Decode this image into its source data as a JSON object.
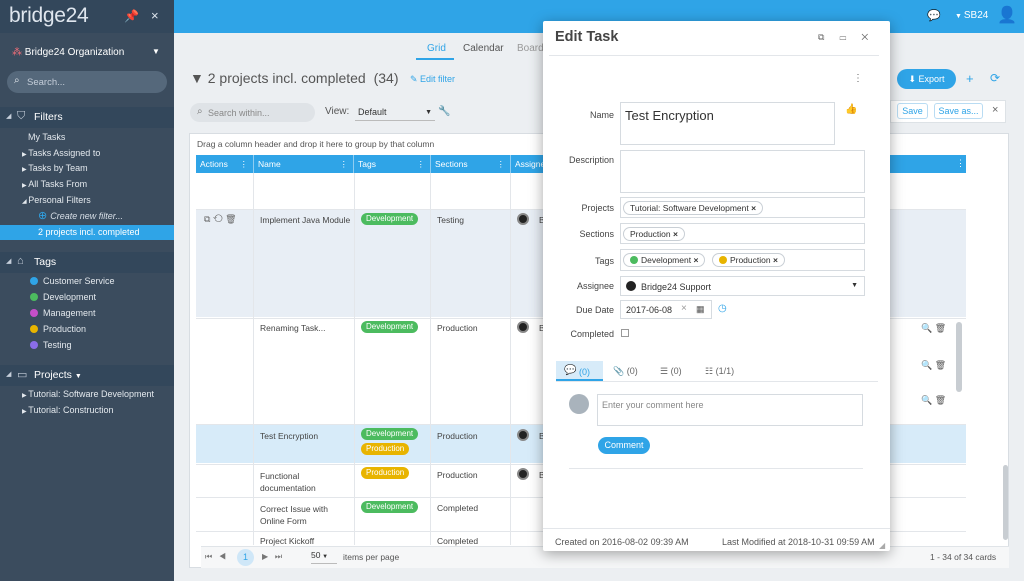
{
  "app": {
    "logo": "bridge24",
    "user": "SB24"
  },
  "sidebar": {
    "org": "Bridge24 Organization",
    "search_placeholder": "Search...",
    "filters_title": "Filters",
    "filters": [
      "My Tasks",
      "Tasks Assigned to",
      "Tasks by Team",
      "All Tasks From",
      "Personal Filters",
      "Create new filter...",
      "2 projects incl. completed"
    ],
    "tags_title": "Tags",
    "tags": [
      {
        "label": "Customer Service",
        "color": "#2fa4e7"
      },
      {
        "label": "Development",
        "color": "#4cbb5f"
      },
      {
        "label": "Management",
        "color": "#c64fc9"
      },
      {
        "label": "Production",
        "color": "#e8b400"
      },
      {
        "label": "Testing",
        "color": "#8a6de9"
      }
    ],
    "projects_title": "Projects",
    "projects": [
      "Tutorial: Software Development",
      "Tutorial: Construction"
    ]
  },
  "view": {
    "tabs": [
      "Grid",
      "Calendar",
      "Board"
    ],
    "title": "2 projects incl. completed",
    "count": "(34)",
    "edit_filter": "Edit filter",
    "search_placeholder": "Search within...",
    "view_label": "View:",
    "view_value": "Default",
    "export": "Export",
    "save": "Save",
    "save_as": "Save as...",
    "group_hint": "Drag a column header and drop it here to group by that column",
    "columns": [
      "Actions",
      "Name",
      "Tags",
      "Sections",
      "Assignee"
    ],
    "rows": [
      {
        "name": "Implement Java Module",
        "tags": [
          "Development"
        ],
        "section": "Testing",
        "assignee": "B"
      },
      {
        "name": "Renaming Task...",
        "tags": [
          "Development"
        ],
        "section": "Production",
        "assignee": "B"
      },
      {
        "name": "Test Encryption",
        "tags": [
          "Development",
          "Production"
        ],
        "section": "Production",
        "assignee": "B"
      },
      {
        "name": "Functional documentation",
        "tags": [
          "Production"
        ],
        "section": "Production",
        "assignee": "B"
      },
      {
        "name": "Correct Issue with Online Form",
        "tags": [
          "Development"
        ],
        "section": "Completed",
        "assignee": ""
      },
      {
        "name": "Project Kickoff",
        "tags": [],
        "section": "Completed",
        "assignee": ""
      }
    ],
    "pager": {
      "page": "1",
      "per_page": "50",
      "per_page_label": "items per page",
      "summary": "1 - 34 of 34 cards"
    }
  },
  "modal": {
    "title": "Edit Task",
    "name_label": "Name",
    "name_value": "Test Encryption",
    "desc_label": "Description",
    "projects_label": "Projects",
    "project": "Tutorial: Software Development",
    "sections_label": "Sections",
    "section": "Production",
    "tags_label": "Tags",
    "tags": [
      {
        "label": "Development",
        "color": "#4cbb5f"
      },
      {
        "label": "Production",
        "color": "#e8b400"
      }
    ],
    "assignee_label": "Assignee",
    "assignee": "Bridge24 Support",
    "due_label": "Due Date",
    "due": "2017-06-08",
    "completed_label": "Completed",
    "tabs": [
      "(0)",
      "(0)",
      "(0)",
      "(1/1)"
    ],
    "comment_placeholder": "Enter your comment here",
    "comment_button": "Comment",
    "created": "Created on 2016-08-02 09:39 AM",
    "modified": "Last Modified at 2018-10-31 09:59 AM"
  }
}
